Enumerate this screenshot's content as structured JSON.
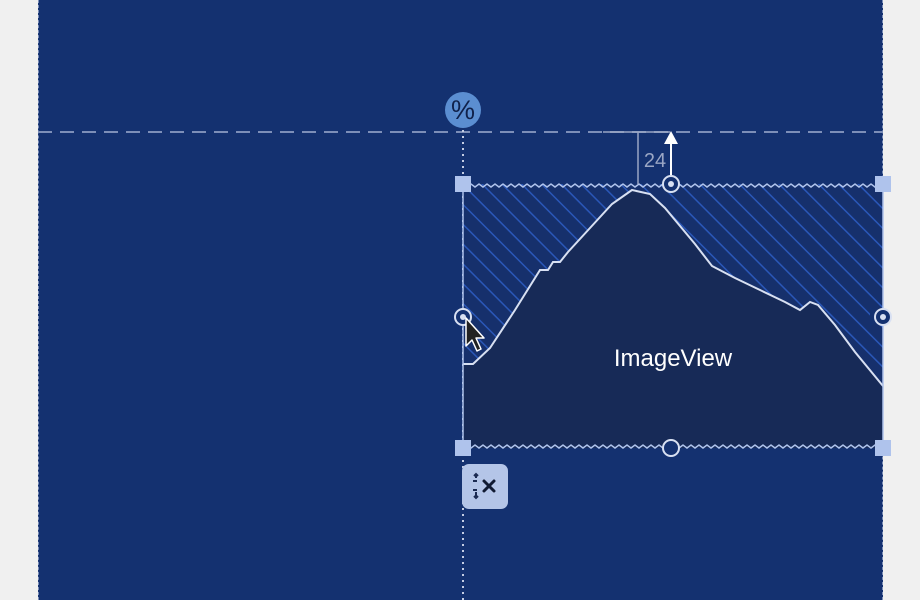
{
  "editor": {
    "guideline": {
      "type_icon": "percent-icon",
      "symbol": "%"
    },
    "selected_view": {
      "label": "ImageView",
      "top_margin": "24"
    },
    "toolbar": {
      "clear_constraints_icon": "clear-constraints-icon"
    },
    "colors": {
      "canvas_background": "#143170",
      "view_fill": "#172a57",
      "view_hatch": "#2a57b8",
      "handle": "#afc3ec",
      "guideline_marker": "#5b8ed1",
      "outside_canvas": "#f0f0f0"
    }
  }
}
